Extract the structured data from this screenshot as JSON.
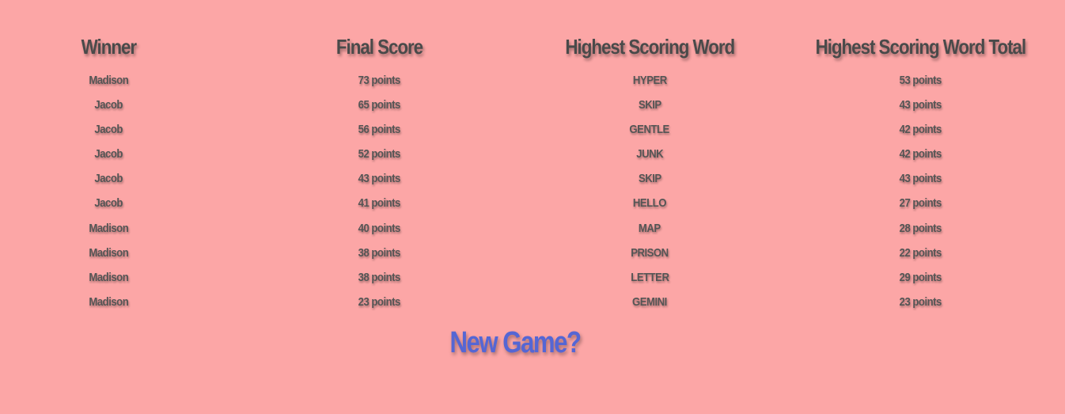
{
  "headers": [
    "Winner",
    "Final Score",
    "Highest Scoring Word",
    "Highest Scoring Word Total"
  ],
  "rows": [
    [
      "Madison",
      "73 points",
      "HYPER",
      "53 points"
    ],
    [
      "Jacob",
      "65 points",
      "SKIP",
      "43 points"
    ],
    [
      "Jacob",
      "56 points",
      "GENTLE",
      "42 points"
    ],
    [
      "Jacob",
      "52 points",
      "JUNK",
      "42 points"
    ],
    [
      "Jacob",
      "43 points",
      "SKIP",
      "43 points"
    ],
    [
      "Jacob",
      "41 points",
      "HELLO",
      "27 points"
    ],
    [
      "Madison",
      "40 points",
      "MAP",
      "28 points"
    ],
    [
      "Madison",
      "38 points",
      "PRISON",
      "22 points"
    ],
    [
      "Madison",
      "38 points",
      "LETTER",
      "29 points"
    ],
    [
      "Madison",
      "23 points",
      "GEMINI",
      "23 points"
    ]
  ],
  "new_game_label": "New Game?",
  "colors": {
    "background": "#fca6a6",
    "text": "#4a4a4a",
    "accent": "#5566d4"
  }
}
